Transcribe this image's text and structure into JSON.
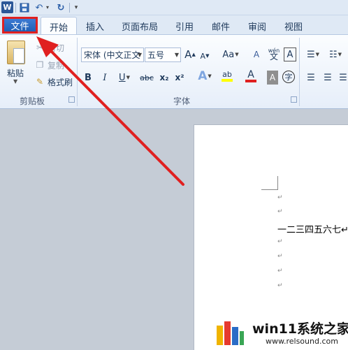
{
  "qat": {
    "app_icon_letter": "W",
    "undo_glyph": "↶",
    "redo_glyph": "↻",
    "more_glyph": "▾"
  },
  "tabs": {
    "file": "文件",
    "home": "开始",
    "insert": "插入",
    "page_layout": "页面布局",
    "references": "引用",
    "mailings": "邮件",
    "review": "审阅",
    "view": "视图"
  },
  "clipboard": {
    "paste": "粘贴",
    "cut": "剪切",
    "copy": "复制",
    "format_painter": "格式刷",
    "group_label": "剪贴板"
  },
  "font": {
    "font_name": "宋体 (中文正文",
    "font_size": "五号",
    "group_label": "字体",
    "bold": "B",
    "italic": "I",
    "underline": "U",
    "strikethrough": "abc",
    "subscript": "x₂",
    "superscript": "x²",
    "grow": "A",
    "shrink": "A",
    "change_case": "Aa",
    "clear_format": "A",
    "phonetic": "wén",
    "phonetic_char": "文",
    "border_char": "A",
    "text_effects": "A",
    "highlight": "ab",
    "font_color": "A",
    "char_shading": "A",
    "enclose_char": "字"
  },
  "document": {
    "paragraph_mark": "↵",
    "line_text": "一二三四五六七↵"
  },
  "watermark": {
    "title": "win11系统之家",
    "url": "www.relsound.com"
  },
  "colors": {
    "file_tab_blue": "#2a6cc6",
    "annotation_red": "#e02020",
    "highlight_yellow": "#ffff00",
    "font_color_red": "#e02020"
  }
}
